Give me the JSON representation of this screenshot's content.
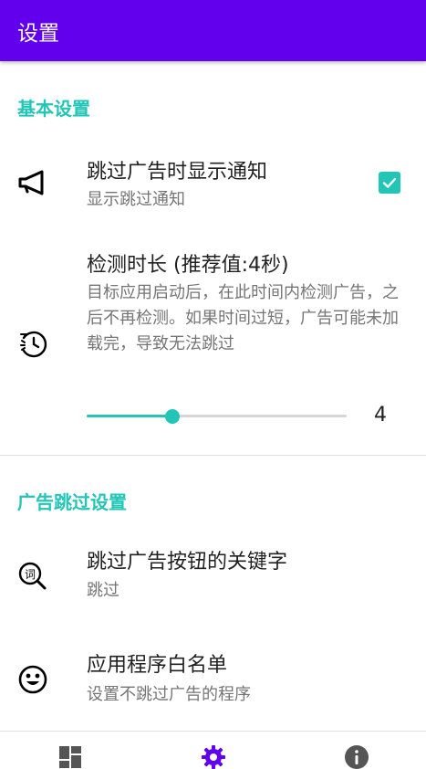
{
  "app": {
    "title": "设置",
    "colors": {
      "primary": "#6200ee",
      "accent": "#22c5b6"
    }
  },
  "sections": {
    "basic": {
      "title": "基本设置",
      "notify": {
        "icon": "megaphone-icon",
        "title": "跳过广告时显示通知",
        "summary": "显示跳过通知",
        "checked": true
      },
      "duration": {
        "icon": "timer-icon",
        "title": "检测时长 (推荐值:4秒)",
        "summary": "目标应用启动后，在此时间内检测广告，之后不再检测。如果时间过短，广告可能未加载完，导致无法跳过",
        "value": "4",
        "slider_fraction": 0.33
      }
    },
    "ad_skip": {
      "title": "广告跳过设置",
      "keywords": {
        "icon": "word-search-icon",
        "title": "跳过广告按钮的关键字",
        "summary": "跳过"
      },
      "whitelist": {
        "icon": "smiley-icon",
        "title": "应用程序白名单",
        "summary": "设置不跳过广告的程序"
      }
    }
  },
  "bottom_nav": {
    "items": [
      {
        "icon": "dashboard-icon",
        "active": false
      },
      {
        "icon": "gear-icon",
        "active": true
      },
      {
        "icon": "info-icon",
        "active": false
      }
    ]
  }
}
